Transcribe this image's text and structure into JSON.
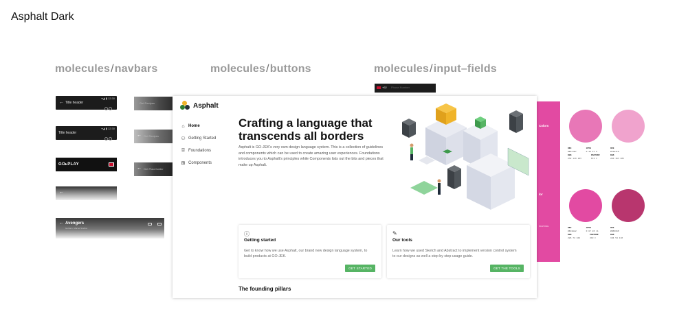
{
  "page": {
    "title": "Asphalt Dark"
  },
  "sections": {
    "navbars": {
      "prefix": "molecules",
      "name": "navbars"
    },
    "buttons": {
      "prefix": "molecules",
      "name": "buttons"
    },
    "input_fields": {
      "prefix": "molecules",
      "name": "input–fields"
    }
  },
  "navbar_samples": {
    "title_header_1": "Title header",
    "title_header_2": "Title header",
    "logo": "GO▸PLAY",
    "avengers_title": "Avengers",
    "avengers_sub": "Gotham, Marvel Studios",
    "search_1": "Get Recipes",
    "search_2": "Get Recipes",
    "search_3": "Get Placeholder"
  },
  "input_sample": {
    "code": "+62",
    "placeholder": "Phone Number"
  },
  "site": {
    "brand": "Asphalt",
    "nav": [
      {
        "label": "Home",
        "icon": "home-icon"
      },
      {
        "label": "Getting Started",
        "icon": "people-icon"
      },
      {
        "label": "Foundations",
        "icon": "building-icon"
      },
      {
        "label": "Components",
        "icon": "grid-icon"
      }
    ],
    "hero_title": "Crafting a language that transcends all borders",
    "hero_desc": "Asphalt is GO-JEK's very own design language system. This is a collection of guidelines and components which can be used to create amazing user experiences. Foundations introduces you to Asphalt's principles while Components lists out the bits and pieces that make up Asphalt.",
    "cards": [
      {
        "icon": "question-icon",
        "title": "Getting started",
        "desc": "Get to know how we use Asphalt, our brand new design language system, to build products at GO-JEK.",
        "button": "GET STARTED"
      },
      {
        "icon": "pencil-icon",
        "title": "Our tools",
        "desc": "Learn how we used Sketch and Abstract to implement version control system to our designs as well a step by step usage guide.",
        "button": "GET THE TOOLS"
      }
    ],
    "pillars_heading": "The founding pillars",
    "accent": "#56b464"
  },
  "color_panel": {
    "label_1": "Colors",
    "label_2": "lor",
    "pantone": "PANTONE",
    "accent": "#e24aa2"
  },
  "swatches": [
    {
      "color": "#e877b7",
      "hex": "#E877B7",
      "rgb": "232 119 183",
      "cmyk": "0 49 21 9",
      "pantone": "674 C"
    },
    {
      "color": "#f0a3cd",
      "hex": "#F0A3CD",
      "rgb": "240 163 205",
      "cmyk": "0 32 15 6",
      "pantone": "237 C"
    },
    {
      "color": "#e24aa2",
      "hex": "#E24AA2",
      "rgb": "226 74 162",
      "cmyk": "0 67 28 11",
      "pantone": "219 C"
    },
    {
      "color": "#b8366e",
      "hex": "#B8366E",
      "rgb": "184 54 110",
      "cmyk": "0 71 40 28",
      "pantone": "234 C"
    }
  ]
}
